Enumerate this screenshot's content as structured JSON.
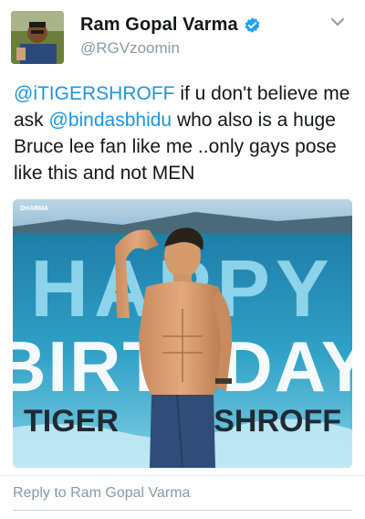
{
  "author": {
    "display_name": "Ram Gopal Varma",
    "handle": "@RGVzoomin",
    "verified": true,
    "avatar_icon": "profile-photo"
  },
  "tweet": {
    "mention_1": "@iTIGERSHROFF",
    "text_1": " if u don't believe me ask ",
    "mention_2": "@bindasbhidu",
    "text_2": " who also is a huge Bruce lee fan like me ..only gays pose like this and not MEN"
  },
  "media": {
    "logo_text": "DHARMA",
    "word_1": "HAPPY",
    "word_2": "BIRTHDAY",
    "name_left": "TIGER",
    "name_right": "SHROFF"
  },
  "reply": {
    "placeholder": "Reply to Ram Gopal Varma"
  },
  "colors": {
    "link": "#1b95e0",
    "verified": "#1da1f2",
    "secondary_text": "#8899a6"
  }
}
